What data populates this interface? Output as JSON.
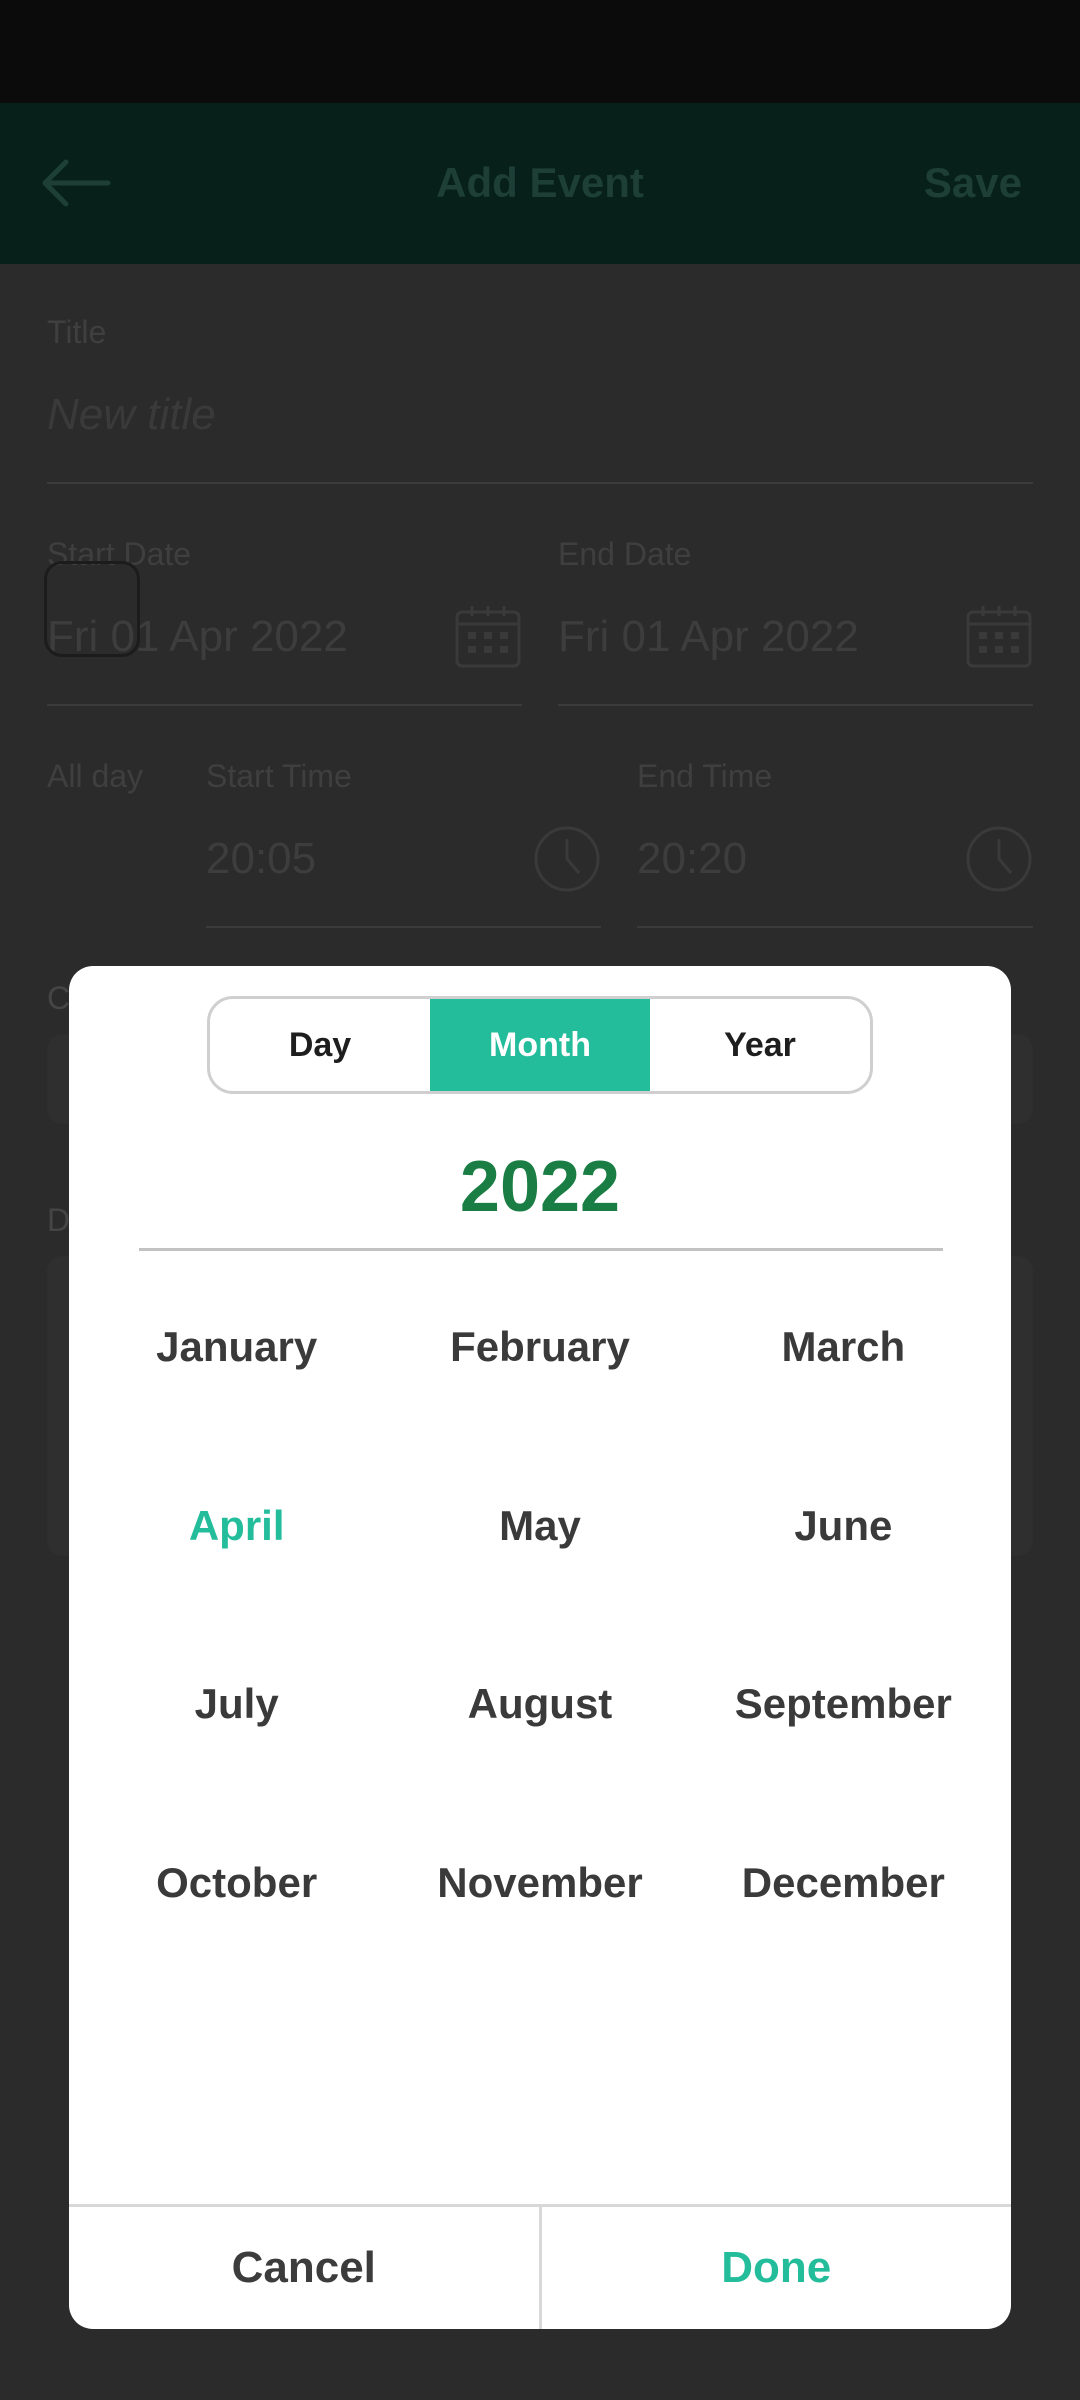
{
  "app_bar": {
    "title": "Add Event",
    "save_label": "Save"
  },
  "form": {
    "title_label": "Title",
    "title_placeholder": "New title",
    "start_date_label": "Start Date",
    "start_date_value": "Fri 01 Apr 2022",
    "end_date_label": "End Date",
    "end_date_value": "Fri 01 Apr 2022",
    "all_day_label": "All day",
    "start_time_label": "Start Time",
    "start_time_value": "20:05",
    "end_time_label": "End Time",
    "end_time_value": "20:20",
    "partial_label_1": "C",
    "partial_label_2": "D"
  },
  "picker": {
    "tabs": [
      {
        "label": "Day",
        "active": false
      },
      {
        "label": "Month",
        "active": true
      },
      {
        "label": "Year",
        "active": false
      }
    ],
    "year": "2022",
    "selected_month": "April",
    "months": [
      "January",
      "February",
      "March",
      "April",
      "May",
      "June",
      "July",
      "August",
      "September",
      "October",
      "November",
      "December"
    ],
    "cancel_label": "Cancel",
    "done_label": "Done"
  },
  "colors": {
    "accent": "#23bd9b",
    "year_green": "#1a7e44",
    "app_bar": "#07211a"
  },
  "icons": [
    "arrow-left-icon",
    "calendar-icon",
    "clock-icon"
  ]
}
